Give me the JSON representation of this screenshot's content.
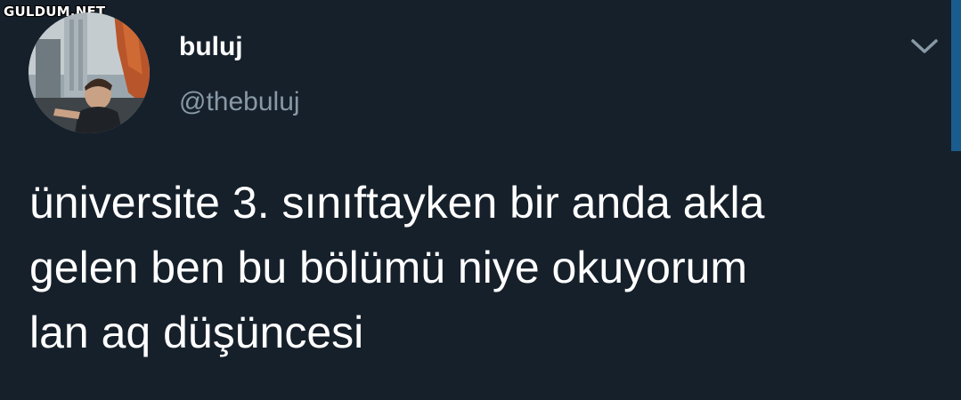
{
  "watermark": {
    "text": "GULDUM.NET"
  },
  "tweet": {
    "author": {
      "display_name": "buluj",
      "handle": "@thebuluj",
      "avatar_icon": "profile-photo"
    },
    "menu_icon": "chevron-down-icon",
    "text_lines": [
      "üniversite 3. sınıftayken bir anda akla",
      "gelen ben bu bölümü niye okuyorum",
      "lan aq düşüncesi"
    ]
  },
  "colors": {
    "background": "#16202b",
    "text_primary": "#ffffff",
    "text_secondary": "#8899a6",
    "scrollbar": "#1b5c8f"
  }
}
